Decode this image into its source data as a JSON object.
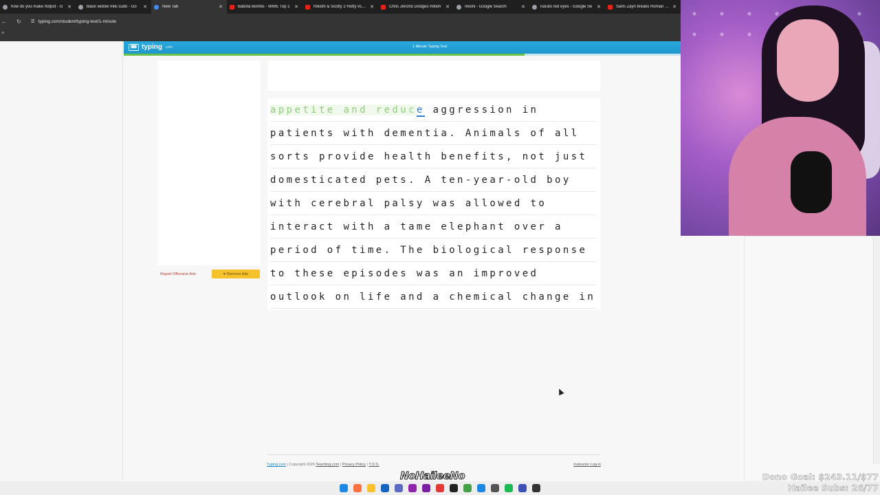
{
  "browser": {
    "tabs": [
      {
        "title": "how do you make hotpot - G",
        "icon": "google-icon",
        "active": false
      },
      {
        "title": "black widow miki sudo - Go",
        "icon": "google-icon",
        "active": false
      },
      {
        "title": "New Tab",
        "icon": "chrome-icon",
        "active": true
      },
      {
        "title": "Batista Bombs - WWE Top 1",
        "icon": "youtube-icon",
        "active": false
      },
      {
        "title": "Rikishi & Scotty 2 Hotty vs. R",
        "icon": "youtube-icon",
        "active": false
      },
      {
        "title": "Chris Jericho Dodges Rikish",
        "icon": "youtube-icon",
        "active": false
      },
      {
        "title": "rikishi - Google Search",
        "icon": "google-icon",
        "active": false
      },
      {
        "title": "naruto red eyes - Google Se",
        "icon": "google-icon",
        "active": false
      },
      {
        "title": "Sami Zayn breaks Roman Re",
        "icon": "youtube-icon",
        "active": false
      }
    ],
    "url": "typing.com/student/typing-test/1-minute"
  },
  "site": {
    "logo_text": "typing",
    "logo_suffix": ".com",
    "test_title": "1 Minute Typing Test",
    "progress_fraction": 0.72,
    "report_label": "Report Offensive Ads",
    "remove_ads_label": "Remove Ads"
  },
  "typing": {
    "lines": [
      {
        "typed": "appetite and reduc",
        "cursor": "e",
        "rest": " aggression in"
      },
      {
        "typed": "",
        "cursor": "",
        "rest": "patients with dementia. Animals of all"
      },
      {
        "typed": "",
        "cursor": "",
        "rest": "sorts provide health benefits, not just"
      },
      {
        "typed": "",
        "cursor": "",
        "rest": "domesticated pets. A ten-year-old boy"
      },
      {
        "typed": "",
        "cursor": "",
        "rest": "with cerebral palsy was allowed to"
      },
      {
        "typed": "",
        "cursor": "",
        "rest": "interact with a tame elephant over a"
      },
      {
        "typed": "",
        "cursor": "",
        "rest": "period of time. The biological response"
      },
      {
        "typed": "",
        "cursor": "",
        "rest": "to these episodes was an improved"
      },
      {
        "typed": "",
        "cursor": "",
        "rest": "outlook on life and a chemical change in"
      }
    ]
  },
  "footer": {
    "brand": "Typing.com",
    "copyright": "| Copyright 2026",
    "teaching": "Teaching.com",
    "privacy": "Privacy Policy",
    "tos": "T.O.S.",
    "instructor": "Instructor Log-in"
  },
  "overlay": {
    "stream_logo": "NoHaileeNo",
    "dono_goal": "Dono Goal: $243.11/$77",
    "subs": "Hailee Subs: 26/77"
  },
  "colors": {
    "header_blue": "#29a9de",
    "typed_green": "#8fcf7c",
    "cursor_blue": "#2b7bd6",
    "remove_ads_yellow": "#f5c22b"
  }
}
